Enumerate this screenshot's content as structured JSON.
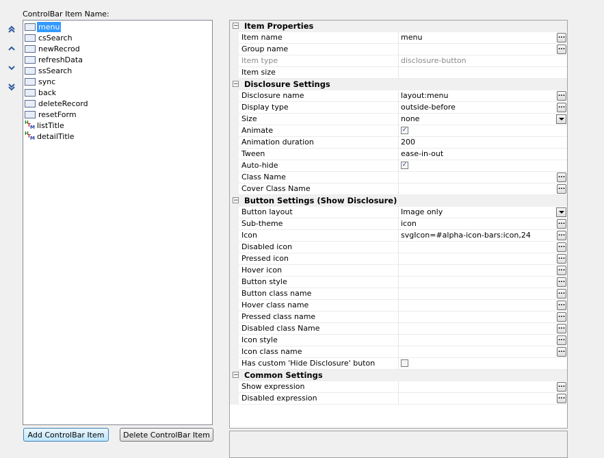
{
  "list": {
    "label": "ControlBar Item Name:",
    "items": [
      {
        "name": "menu",
        "icon": "abc-icon",
        "selected": true
      },
      {
        "name": "csSearch",
        "icon": "abc-icon"
      },
      {
        "name": "newRecrod",
        "icon": "abc-icon"
      },
      {
        "name": "refreshData",
        "icon": "abc-icon"
      },
      {
        "name": "ssSearch",
        "icon": "abc-icon"
      },
      {
        "name": "sync",
        "icon": "abc-icon"
      },
      {
        "name": "back",
        "icon": "abc-icon"
      },
      {
        "name": "deleteRecord",
        "icon": "abc-icon"
      },
      {
        "name": "resetForm",
        "icon": "abc-icon"
      },
      {
        "name": "listTitle",
        "icon": "htm-icon"
      },
      {
        "name": "detailTitle",
        "icon": "htm-icon"
      }
    ]
  },
  "move_buttons": [
    "move-top-icon",
    "move-up-icon",
    "move-down-icon",
    "move-bottom-icon"
  ],
  "buttons": {
    "add": "Add ControlBar Item",
    "delete": "Delete ControlBar Item"
  },
  "properties": [
    {
      "category": "Item Properties",
      "rows": [
        {
          "name": "Item name",
          "value": "menu",
          "editor": "ellipsis"
        },
        {
          "name": "Group name",
          "value": "",
          "editor": "ellipsis"
        },
        {
          "name": "Item type",
          "value": "disclosure-button",
          "editor": "none",
          "disabled": true
        },
        {
          "name": "Item size",
          "value": "",
          "editor": "none"
        }
      ]
    },
    {
      "category": "Disclosure Settings",
      "rows": [
        {
          "name": "Disclosure name",
          "value": "layout:menu",
          "editor": "ellipsis"
        },
        {
          "name": "Display type",
          "value": "outside-before",
          "editor": "ellipsis"
        },
        {
          "name": "Size",
          "value": "none",
          "editor": "dropdown"
        },
        {
          "name": "Animate",
          "value": "",
          "editor": "checkbox",
          "checked": true
        },
        {
          "name": "Animation duration",
          "value": "200",
          "editor": "none"
        },
        {
          "name": "Tween",
          "value": "ease-in-out",
          "editor": "none"
        },
        {
          "name": "Auto-hide",
          "value": "",
          "editor": "checkbox",
          "checked": true
        },
        {
          "name": "Class Name",
          "value": "",
          "editor": "ellipsis"
        },
        {
          "name": "Cover Class Name",
          "value": "",
          "editor": "ellipsis"
        }
      ]
    },
    {
      "category": "Button Settings (Show Disclosure)",
      "rows": [
        {
          "name": "Button layout",
          "value": "Image only",
          "editor": "dropdown"
        },
        {
          "name": "Sub-theme",
          "value": "icon",
          "editor": "ellipsis"
        },
        {
          "name": "Icon",
          "value": "svgIcon=#alpha-icon-bars:icon,24",
          "editor": "ellipsis"
        },
        {
          "name": "Disabled icon",
          "value": "",
          "editor": "ellipsis"
        },
        {
          "name": "Pressed icon",
          "value": "",
          "editor": "ellipsis"
        },
        {
          "name": "Hover icon",
          "value": "",
          "editor": "ellipsis"
        },
        {
          "name": "Button style",
          "value": "",
          "editor": "ellipsis"
        },
        {
          "name": "Button class name",
          "value": "",
          "editor": "ellipsis"
        },
        {
          "name": "Hover class name",
          "value": "",
          "editor": "ellipsis"
        },
        {
          "name": "Pressed class name",
          "value": "",
          "editor": "ellipsis"
        },
        {
          "name": "Disabled class Name",
          "value": "",
          "editor": "ellipsis"
        },
        {
          "name": "Icon style",
          "value": "",
          "editor": "ellipsis"
        },
        {
          "name": "Icon class name",
          "value": "",
          "editor": "ellipsis"
        },
        {
          "name": "Has custom 'Hide Disclosure' buton",
          "value": "",
          "editor": "checkbox",
          "checked": false
        }
      ]
    },
    {
      "category": "Common Settings",
      "rows": [
        {
          "name": "Show expression",
          "value": "",
          "editor": "ellipsis"
        },
        {
          "name": "Disabled expression",
          "value": "",
          "editor": "ellipsis"
        }
      ]
    }
  ],
  "glyphs": {
    "collapse": "−",
    "ellipsis": "...",
    "check": "✓"
  }
}
